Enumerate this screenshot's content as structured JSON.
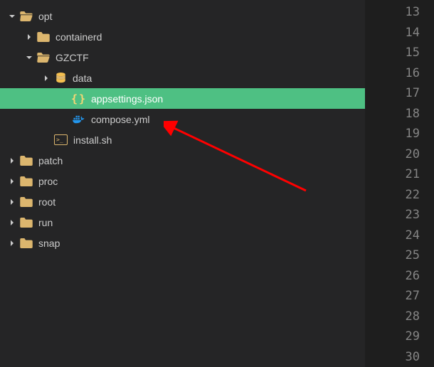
{
  "tree": {
    "opt": {
      "label": "opt"
    },
    "containerd": {
      "label": "containerd"
    },
    "gzctf": {
      "label": "GZCTF"
    },
    "data": {
      "label": "data"
    },
    "appsettings": {
      "label": "appsettings.json"
    },
    "compose": {
      "label": "compose.yml"
    },
    "install": {
      "label": "install.sh"
    },
    "patch": {
      "label": "patch"
    },
    "proc": {
      "label": "proc"
    },
    "root": {
      "label": "root"
    },
    "run": {
      "label": "run"
    },
    "snap": {
      "label": "snap"
    }
  },
  "folder_colors": {
    "open": "#dcb66e",
    "closed": "#dcb66e"
  },
  "selection_color": "#4ec083",
  "arrow_color": "#ff0000",
  "line_numbers": [
    "13",
    "14",
    "15",
    "16",
    "17",
    "18",
    "19",
    "20",
    "21",
    "22",
    "23",
    "24",
    "25",
    "26",
    "27",
    "28",
    "29",
    "30"
  ]
}
